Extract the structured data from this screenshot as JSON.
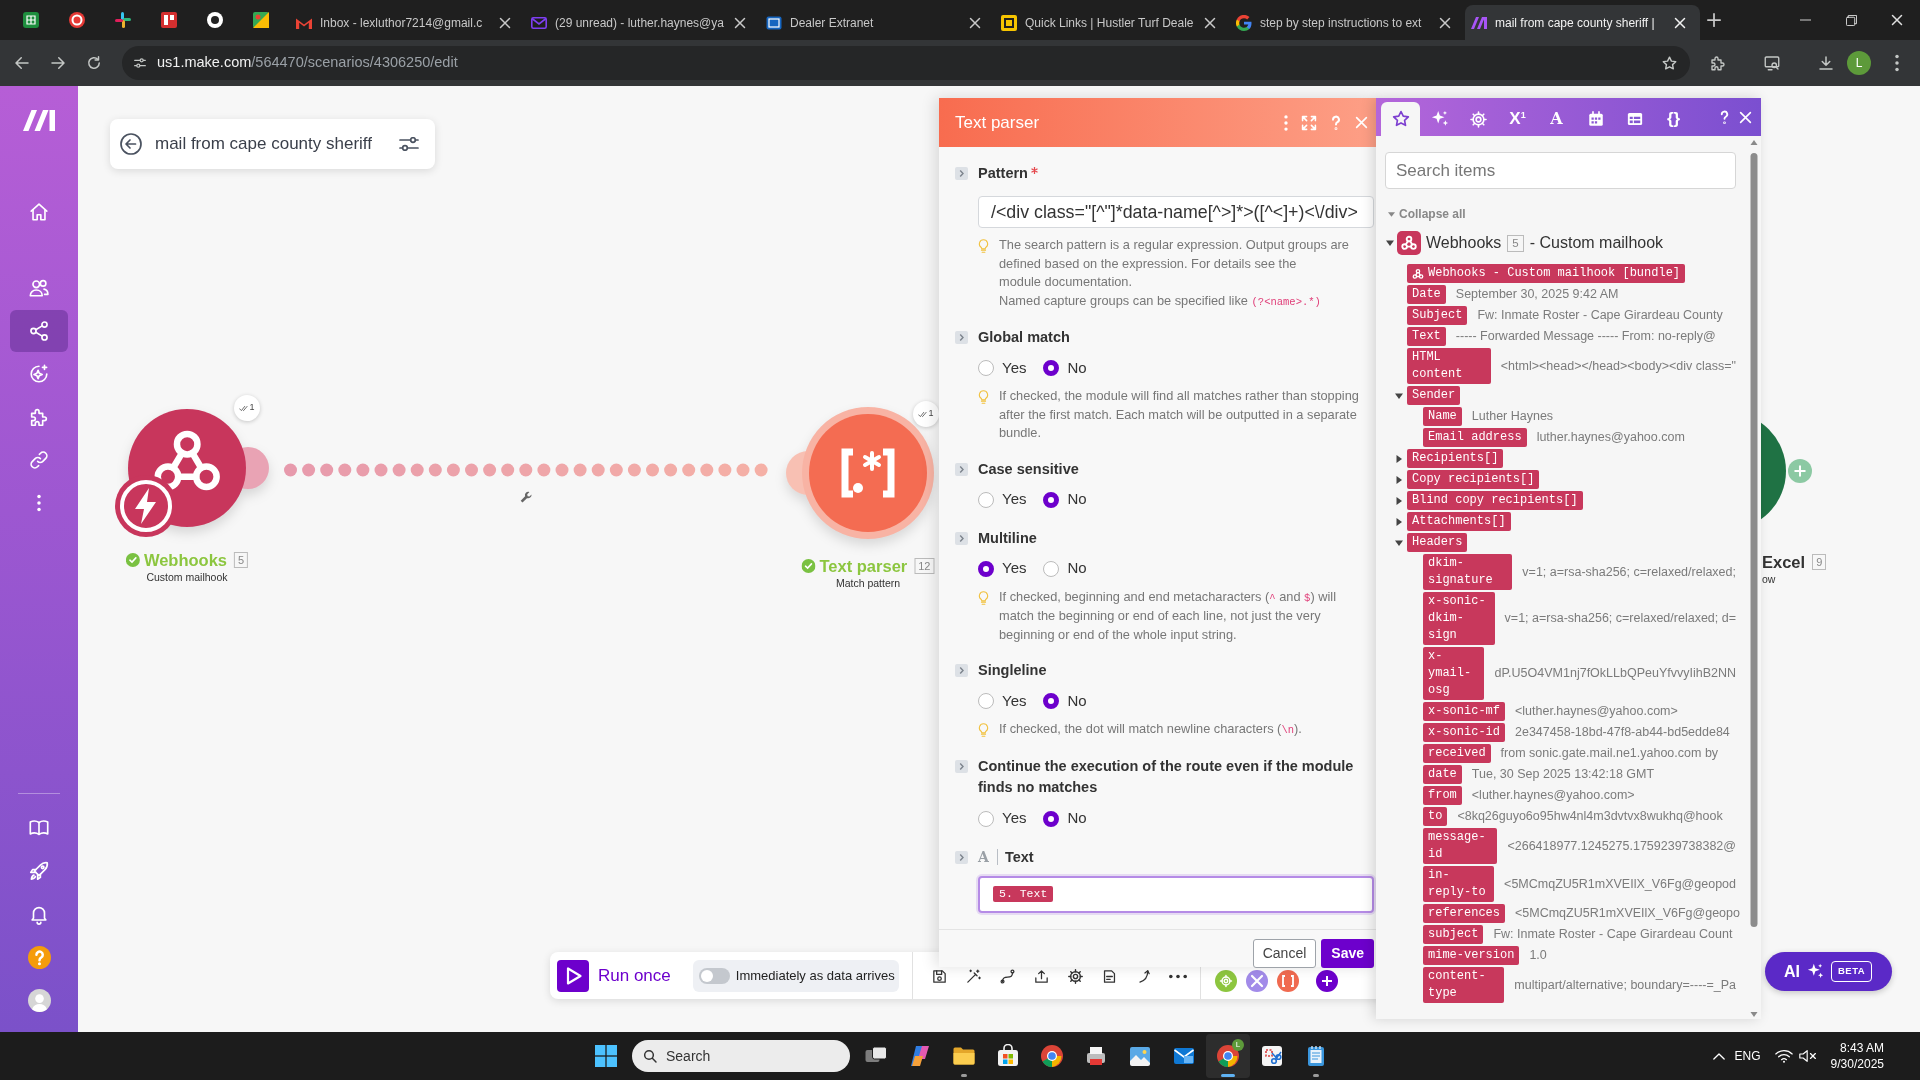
{
  "browser": {
    "tabs": [
      {
        "kind": "gmail",
        "title": "Inbox - lexluthor7214@gmail.c",
        "selected": false
      },
      {
        "kind": "yahoo",
        "title": "(29 unread) - luther.haynes@ya",
        "selected": false
      },
      {
        "kind": "extranet",
        "title": "Dealer Extranet",
        "selected": false
      },
      {
        "kind": "hustler",
        "title": "Quick Links | Hustler Turf Deale",
        "selected": false
      },
      {
        "kind": "google",
        "title": "step by step instructions to ext",
        "selected": false
      },
      {
        "kind": "make",
        "title": "mail from cape county sheriff |",
        "selected": true
      }
    ],
    "address": {
      "host": "us1.make.com",
      "path": "/564470/scenarios/4306250/edit"
    },
    "profile": {
      "initial": "L"
    }
  },
  "sidebar": {
    "items": [
      {
        "kind": "home",
        "selected": false
      },
      {
        "kind": "team",
        "selected": false
      },
      {
        "kind": "scenarios",
        "selected": true
      },
      {
        "kind": "ai",
        "selected": false
      },
      {
        "kind": "apps",
        "selected": false
      },
      {
        "kind": "connections",
        "selected": false
      },
      {
        "kind": "more",
        "selected": false
      }
    ],
    "bottom_items": [
      {
        "kind": "docs"
      },
      {
        "kind": "launch"
      },
      {
        "kind": "notifications"
      },
      {
        "kind": "help"
      },
      {
        "kind": "account"
      }
    ]
  },
  "scenario": {
    "name": "mail from cape county sheriff"
  },
  "modules": [
    {
      "kind": "webhooks",
      "title": "Webhooks",
      "number": "5",
      "subtitle": "Custom mailhook",
      "ok": true,
      "operations": "1"
    },
    {
      "kind": "text_parser",
      "title": "Text parser",
      "number": "12",
      "subtitle": "Match pattern",
      "ok": true,
      "operations": "1"
    },
    {
      "kind": "excel",
      "title": "Excel",
      "number": "9",
      "subtitle": "ow",
      "ok": false
    }
  ],
  "toolbar": {
    "run": "Run once",
    "schedule": {
      "label": "Immediately as data arrives",
      "on": false
    }
  },
  "ai_button": {
    "label": "AI",
    "badge": "BETA"
  },
  "module_panel": {
    "title": "Text parser",
    "fields": [
      {
        "kind": "input",
        "label": "Pattern",
        "required": true,
        "value": "/<div class=\"[^\"]*data-name[^>]*>([^<]+)<\\/div>",
        "hints": [
          {
            "parts": [
              {
                "kind": "text",
                "text": "The search pattern is a regular expression. Output groups are defined based on the expression. For details see the "
              },
              {
                "kind": "link",
                "text": "module documentation"
              },
              {
                "kind": "text",
                "text": "."
              }
            ]
          },
          {
            "parts": [
              {
                "kind": "text",
                "text": "Named capture groups can be specified like "
              },
              {
                "kind": "code",
                "text": "(?<name>.*)"
              }
            ]
          }
        ]
      },
      {
        "kind": "radio",
        "label": "Global match",
        "options": [
          {
            "label": "Yes",
            "selected": false
          },
          {
            "label": "No",
            "selected": true
          }
        ],
        "hints": [
          {
            "parts": [
              {
                "kind": "text",
                "text": "If checked, the module will find all matches rather than stopping after the first match. Each match will be outputted in a separate bundle."
              }
            ]
          }
        ]
      },
      {
        "kind": "radio",
        "label": "Case sensitive",
        "options": [
          {
            "label": "Yes",
            "selected": false
          },
          {
            "label": "No",
            "selected": true
          }
        ]
      },
      {
        "kind": "radio",
        "label": "Multiline",
        "options": [
          {
            "label": "Yes",
            "selected": true
          },
          {
            "label": "No",
            "selected": false
          }
        ],
        "hints": [
          {
            "parts": [
              {
                "kind": "text",
                "text": "If checked, beginning and end metacharacters ("
              },
              {
                "kind": "code",
                "text": "^"
              },
              {
                "kind": "text",
                "text": " and "
              },
              {
                "kind": "code",
                "text": "$"
              },
              {
                "kind": "text",
                "text": ") will match the beginning or end of each line, not just the very beginning or end of the whole input string."
              }
            ]
          }
        ]
      },
      {
        "kind": "radio",
        "label": "Singleline",
        "options": [
          {
            "label": "Yes",
            "selected": false
          },
          {
            "label": "No",
            "selected": true
          }
        ],
        "hints": [
          {
            "parts": [
              {
                "kind": "text",
                "text": "If checked, the dot will match newline characters ("
              },
              {
                "kind": "code",
                "text": "\\n"
              },
              {
                "kind": "text",
                "text": ")."
              }
            ]
          }
        ]
      },
      {
        "kind": "radio",
        "label": "Continue the execution of the route even if the module finds no matches",
        "options": [
          {
            "label": "Yes",
            "selected": false
          },
          {
            "label": "No",
            "selected": true
          }
        ]
      },
      {
        "kind": "mapped",
        "label": "Text",
        "type_glyph": "A",
        "focused": true,
        "tokens": [
          "5. Text"
        ]
      }
    ],
    "buttons": [
      {
        "kind": "secondary",
        "label": "Cancel"
      },
      {
        "kind": "primary",
        "label": "Save"
      }
    ]
  },
  "mapping_panel": {
    "tabs": [
      {
        "kind": "favorites",
        "selected": true
      },
      {
        "kind": "ai",
        "selected": false
      },
      {
        "kind": "general",
        "selected": false
      },
      {
        "kind": "math",
        "glyph": "X$^{1}$",
        "selected": false
      },
      {
        "kind": "text",
        "glyph": "A",
        "selected": false
      },
      {
        "kind": "date",
        "selected": false
      },
      {
        "kind": "array",
        "selected": false
      },
      {
        "kind": "json",
        "glyph": "{}",
        "selected": false
      }
    ],
    "search": {
      "placeholder": "Search items"
    },
    "collapse": "Collapse all",
    "source": {
      "title": "Webhooks",
      "number": "5",
      "subtitle": "- Custom mailhook",
      "expanded": true
    },
    "items": [
      {
        "kind": "bundle",
        "label": "Webhooks - Custom mailhook [bundle]"
      },
      {
        "label": "Date",
        "value": "September 30, 2025 9:42 AM"
      },
      {
        "label": "Subject",
        "value": "Fw: Inmate Roster - Cape Girardeau County"
      },
      {
        "label": "Text",
        "value": "----- Forwarded Message ----- From: no-reply@"
      },
      {
        "label": "HTML content",
        "value": "<html><head></head><body><div class=\""
      },
      {
        "label": "Sender",
        "expanded": true,
        "children": [
          {
            "label": "Name",
            "value": "Luther Haynes"
          },
          {
            "label": "Email address",
            "value": "luther.haynes@yahoo.com"
          }
        ]
      },
      {
        "label": "Recipients[]",
        "expanded": false
      },
      {
        "label": "Copy recipients[]",
        "expanded": false
      },
      {
        "label": "Blind copy recipients[]",
        "expanded": false
      },
      {
        "label": "Attachments[]",
        "expanded": false
      },
      {
        "label": "Headers",
        "expanded": true,
        "children": [
          {
            "label": "dkim-signature",
            "value": "v=1; a=rsa-sha256; c=relaxed/relaxed;"
          },
          {
            "label": "x-sonic-dkim-sign",
            "value": "v=1; a=rsa-sha256; c=relaxed/relaxed; d="
          },
          {
            "label": "x-ymail-osg",
            "value": "dP.U5O4VM1nj7fOkLLbQPeuYfvvyIihB2NN"
          },
          {
            "label": "x-sonic-mf",
            "value": "<luther.haynes@yahoo.com>"
          },
          {
            "label": "x-sonic-id",
            "value": "2e347458-18bd-47f8-ab44-bd5edde84"
          },
          {
            "label": "received",
            "value": "from sonic.gate.mail.ne1.yahoo.com by"
          },
          {
            "label": "date",
            "value": "Tue, 30 Sep 2025 13:42:18 GMT"
          },
          {
            "label": "from",
            "value": "<luther.haynes@yahoo.com>"
          },
          {
            "label": "to",
            "value": "<8kq26guyo6o95hw4nl4m3dvtvx8wukhq@hook"
          },
          {
            "label": "message-id",
            "value": "<266418977.1245275.1759239738382@"
          },
          {
            "label": "in-reply-to",
            "value": "<5MCmqZU5R1mXVEIlX_V6Fg@geopod"
          },
          {
            "label": "references",
            "value": "<5MCmqZU5R1mXVEIlX_V6Fg@geopo"
          },
          {
            "label": "subject",
            "value": "Fw: Inmate Roster - Cape Girardeau Count"
          },
          {
            "label": "mime-version",
            "value": "1.0"
          },
          {
            "label": "content-type",
            "value": "multipart/alternative; boundary=----=_Pa"
          }
        ]
      }
    ]
  },
  "taskbar": {
    "search": {
      "placeholder": "Search"
    },
    "apps": [
      {
        "kind": "task_view",
        "running": false,
        "selected": false
      },
      {
        "kind": "swirl",
        "running": false,
        "selected": false
      },
      {
        "kind": "explorer",
        "running": true,
        "selected": false
      },
      {
        "kind": "store",
        "running": false,
        "selected": false
      },
      {
        "kind": "chrome",
        "running": false,
        "selected": false
      },
      {
        "kind": "scanner",
        "running": false,
        "selected": false
      },
      {
        "kind": "photos",
        "running": false,
        "selected": false
      },
      {
        "kind": "mail",
        "running": false,
        "selected": false
      },
      {
        "kind": "chrome",
        "badge": "L",
        "running": true,
        "selected": true
      },
      {
        "kind": "snipping",
        "running": false,
        "selected": false
      },
      {
        "kind": "notepad",
        "running": true,
        "selected": false
      }
    ],
    "tray": {
      "language": "ENG",
      "time": "8:43 AM",
      "date": "9/30/2025"
    }
  }
}
